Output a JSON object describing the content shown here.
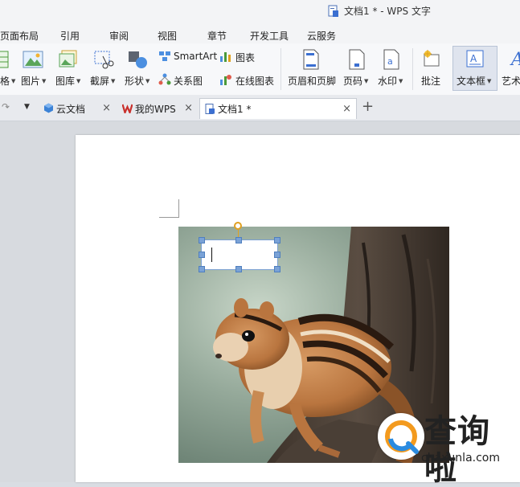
{
  "window": {
    "title": "文档1 * - WPS 文字"
  },
  "menu": {
    "items": [
      {
        "label": "页面布局"
      },
      {
        "label": "引用"
      },
      {
        "label": "审阅"
      },
      {
        "label": "视图"
      },
      {
        "label": "章节"
      },
      {
        "label": "开发工具"
      },
      {
        "label": "云服务"
      }
    ]
  },
  "ribbon": {
    "table_partial": "格",
    "picture": "图片",
    "gallery": "图库",
    "screenshot": "截屏",
    "shapes": "形状",
    "smartart": "SmartArt",
    "relation_chart": "关系图",
    "chart": "图表",
    "online_chart": "在线图表",
    "header_footer": "页眉和页脚",
    "page_number": "页码",
    "watermark": "水印",
    "comment": "批注",
    "textbox": "文本框",
    "art_partial": "艺术"
  },
  "tabs": [
    {
      "label": "云文档"
    },
    {
      "label": "我的WPS"
    },
    {
      "label": "文档1 *"
    }
  ],
  "watermark": {
    "brand_text": "查询啦",
    "url_text": "chaxunla.com"
  },
  "colors": {
    "wps_red": "#c9302c",
    "accent_blue": "#3b6fd1",
    "handle_blue": "#7aa2d6",
    "watermark_orange": "#f39a1e",
    "watermark_blue": "#2a8be0"
  }
}
